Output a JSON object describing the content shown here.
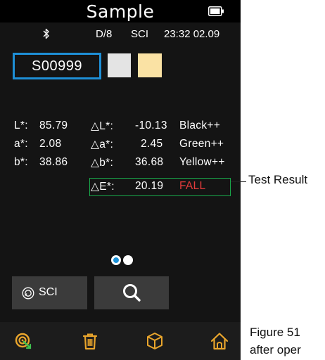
{
  "header": {
    "title": "Sample"
  },
  "status": {
    "geometry": "D/8",
    "mode": "SCI",
    "time": "23:32 02.09"
  },
  "sample": {
    "id": "S00999",
    "standard_color": "#e4e4e4",
    "sample_color": "#fae2a4"
  },
  "measurements": {
    "absolute": [
      {
        "label": "L*:",
        "value": "85.79"
      },
      {
        "label": "a*:",
        "value": "2.08"
      },
      {
        "label": "b*:",
        "value": "38.86"
      }
    ],
    "deltas": [
      {
        "label": "△L*:",
        "value": "-10.13",
        "note": "Black++"
      },
      {
        "label": "△a*:",
        "value": "2.45",
        "note": "Green++"
      },
      {
        "label": "△b*:",
        "value": "36.68",
        "note": "Yellow++"
      }
    ],
    "total": {
      "label": "△E*:",
      "value": "20.19",
      "result": "FALL"
    }
  },
  "pager": {
    "current": 1,
    "total": 2
  },
  "buttons": {
    "sci_label": "SCI",
    "sci_icon": "measure-mode-icon",
    "search_icon": "search-icon"
  },
  "nav": [
    {
      "icon": "measure-target-icon"
    },
    {
      "icon": "trash-icon"
    },
    {
      "icon": "box-icon"
    },
    {
      "icon": "home-icon"
    }
  ],
  "annotations": {
    "callout": "Test Result",
    "caption_line1": "Figure 51",
    "caption_line2": "after oper"
  },
  "colors": {
    "accent_blue": "#1e8fd6",
    "result_border": "#19a84a",
    "fail_red": "#e43b3b",
    "background": "#141414"
  }
}
